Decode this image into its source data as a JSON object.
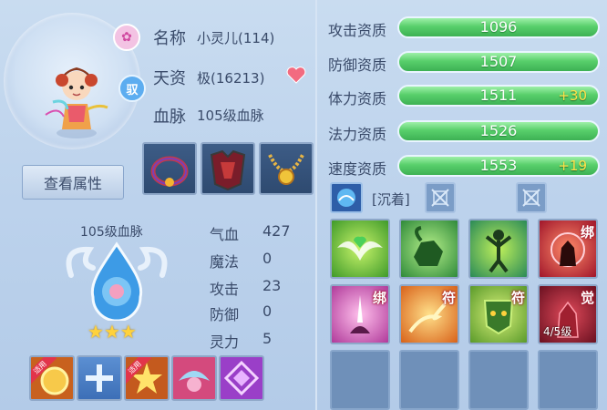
{
  "pet": {
    "name_label": "名称",
    "name_value": "小灵儿(114)",
    "talent_label": "天资",
    "talent_value": "极(16213)",
    "bloodline_label": "血脉",
    "bloodline_value": "105级血脉",
    "bound_badge": "驭"
  },
  "view_button": "查看属性",
  "bloodline_panel": {
    "title": "105级血脉",
    "stars": 3
  },
  "attributes": [
    {
      "label": "气血",
      "value": "427"
    },
    {
      "label": "魔法",
      "value": "0"
    },
    {
      "label": "攻击",
      "value": "23"
    },
    {
      "label": "防御",
      "value": "0"
    },
    {
      "label": "灵力",
      "value": "5"
    }
  ],
  "aptitudes": [
    {
      "label": "攻击资质",
      "value": "1096",
      "bonus": ""
    },
    {
      "label": "防御资质",
      "value": "1507",
      "bonus": ""
    },
    {
      "label": "体力资质",
      "value": "1511",
      "bonus": "+30"
    },
    {
      "label": "法力资质",
      "value": "1526",
      "bonus": ""
    },
    {
      "label": "速度资质",
      "value": "1553",
      "bonus": "+19"
    }
  ],
  "trait": {
    "label": "[沉着]"
  },
  "equip_tags": {
    "slot1": "适用",
    "slot3": "适用"
  },
  "skills": [
    {
      "icon": "heart-wings-icon",
      "char": "",
      "level": ""
    },
    {
      "icon": "ram-icon",
      "char": "",
      "level": ""
    },
    {
      "icon": "vine-figure-icon",
      "char": "",
      "level": ""
    },
    {
      "icon": "red-demon-icon",
      "char": "绑",
      "level": ""
    },
    {
      "icon": "pink-meditate-icon",
      "char": "绑",
      "level": ""
    },
    {
      "icon": "fire-hand-icon",
      "char": "符",
      "level": ""
    },
    {
      "icon": "green-mask-icon",
      "char": "符",
      "level": ""
    },
    {
      "icon": "red-warrior-icon",
      "char": "觉",
      "level": "4/5级"
    }
  ],
  "colors": {
    "bar_green": "#4cc262",
    "bonus_yellow": "#ffe24a",
    "slot_blue": "#6f90b9"
  }
}
